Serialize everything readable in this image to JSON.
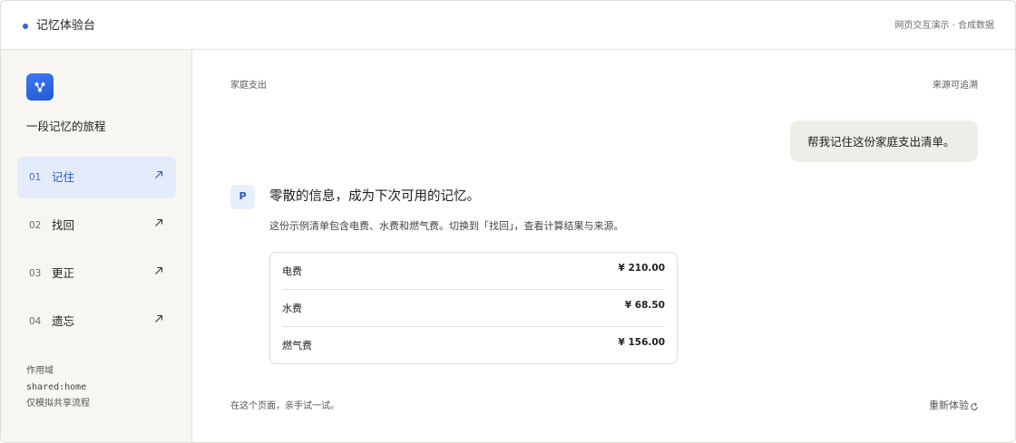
{
  "header": {
    "title": "记忆体验台",
    "right_text": "网页交互演示 · 合成数据"
  },
  "sidebar": {
    "logo_icon": "share-nodes-icon",
    "title": "一段记忆的旅程",
    "items": [
      {
        "num": "01",
        "label": "记住",
        "active": true
      },
      {
        "num": "02",
        "label": "找回",
        "active": false
      },
      {
        "num": "03",
        "label": "更正",
        "active": false
      },
      {
        "num": "04",
        "label": "遗忘",
        "active": false
      }
    ],
    "scope_label": "作用域",
    "scope_value": "shared:home",
    "scope_note": "仅模拟共享流程"
  },
  "main": {
    "breadcrumb": "家庭支出",
    "source_label": "来源可追溯",
    "user_message": "帮我记住这份家庭支出清单。",
    "assistant_avatar": "P",
    "reply_title": "零散的信息，成为下次可用的记忆。",
    "reply_text": "这份示例清单包含电费、水费和燃气费。切换到「找回」，查看计算结果与来源。",
    "bill": [
      {
        "name": "电费",
        "amount": "¥ 210.00"
      },
      {
        "name": "水费",
        "amount": "¥ 68.50"
      },
      {
        "name": "燃气费",
        "amount": "¥ 156.00"
      }
    ],
    "footer_text": "在这个页面，亲手试一试。",
    "restart_label": "重新体验"
  },
  "colors": {
    "accent": "#2f63e0",
    "active_bg": "#e4ebfb",
    "sidebar_bg": "#f7f6f2",
    "bubble_bg": "#efede7"
  }
}
